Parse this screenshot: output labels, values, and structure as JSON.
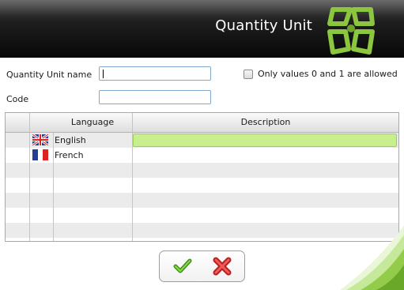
{
  "header": {
    "title": "Quantity Unit"
  },
  "form": {
    "name_label": "Quantity Unit name",
    "name_value": "",
    "code_label": "Code",
    "code_value": "",
    "binary_only_label": "Only values 0 and 1 are allowed",
    "binary_only_checked": false
  },
  "grid": {
    "columns": [
      "Language",
      "Description"
    ],
    "rows": [
      {
        "flag": "uk-flag-icon",
        "language": "English",
        "description": ""
      },
      {
        "flag": "france-flag-icon",
        "language": "French",
        "description": ""
      }
    ],
    "edit_highlight_color": "#c9ee8e"
  },
  "buttons": {
    "ok_icon": "green-checkmark-icon",
    "cancel_icon": "red-x-icon"
  },
  "colors": {
    "header_bg": "#0b0b0b",
    "brand_green": "#8cc63f"
  }
}
